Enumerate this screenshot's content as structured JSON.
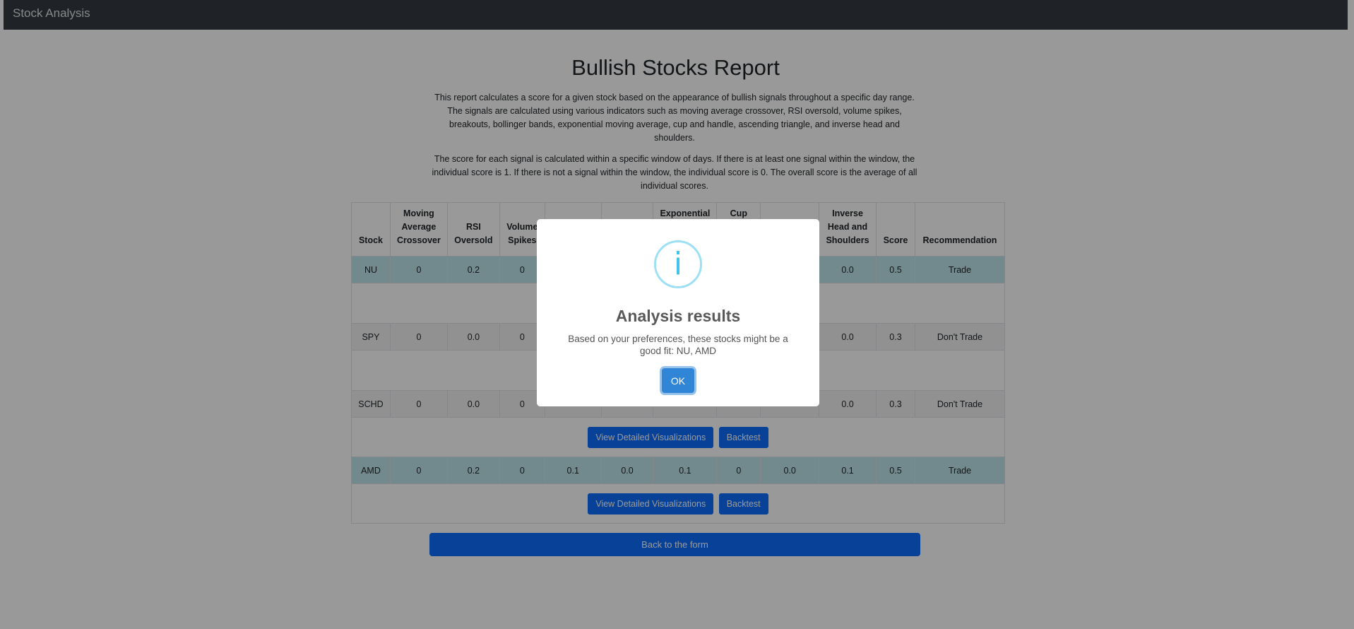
{
  "navbar": {
    "brand": "Stock Analysis"
  },
  "report": {
    "title": "Bullish Stocks Report",
    "intro_1": "This report calculates a score for a given stock based on the appearance of bullish signals throughout a specific day range. The signals are calculated using various indicators such as moving average crossover, RSI oversold, volume spikes, breakouts, bollinger bands, exponential moving average, cup and handle, ascending triangle, and inverse head and shoulders.",
    "intro_2": "The score for each signal is calculated within a specific window of days. If there is at least one signal within the window, the individual score is 1. If there is not a signal within the window, the individual score is 0. The overall score is the average of all individual scores."
  },
  "table": {
    "headers": {
      "stock": "Stock",
      "mac_1": "Moving",
      "mac_2": "Average",
      "mac_3": "Crossover",
      "rsi_1": "RSI",
      "rsi_2": "Oversold",
      "vol_1": "Volume",
      "vol_2": "Spikes",
      "ema_1": "Exponential",
      "cup_1": "Cup",
      "ihs_1": "Inverse",
      "ihs_2": "Head and",
      "ihs_3": "Shoulders",
      "score": "Score",
      "recommendation": "Recommendation"
    },
    "rows": [
      {
        "stock": "NU",
        "mac": "0",
        "rsi": "0.2",
        "vol": "0",
        "ihs": "0.0",
        "score": "0.5",
        "rec": "Trade"
      },
      {
        "stock": "SPY",
        "mac": "0",
        "rsi": "0.0",
        "vol": "0",
        "ihs": "0.0",
        "score": "0.3",
        "rec": "Don't Trade"
      },
      {
        "stock": "SCHD",
        "mac": "0",
        "rsi": "0.0",
        "vol": "0",
        "ihs": "0.0",
        "score": "0.3",
        "rec": "Don't Trade"
      },
      {
        "stock": "AMD",
        "mac": "0",
        "rsi": "0.2",
        "vol": "0",
        "c5": "0.1",
        "c6": "0.0",
        "ema": "0.1",
        "cup": "0",
        "c9": "0.0",
        "ihs": "0.1",
        "score": "0.5",
        "rec": "Trade"
      }
    ],
    "viz_label": "View Detailed Visualizations",
    "backtest_label": "Backtest"
  },
  "back_label": "Back to the form",
  "modal": {
    "icon": "info-icon",
    "icon_glyph": "i",
    "title": "Analysis results",
    "text": "Based on your preferences, these stocks might be a good fit: NU, AMD",
    "ok_label": "OK"
  },
  "colors": {
    "navbar": "#343a40",
    "primary": "#0d6efd",
    "trade_row": "#bee5eb",
    "info_icon": "#3fc3ee",
    "ok_button": "#3085d6"
  }
}
